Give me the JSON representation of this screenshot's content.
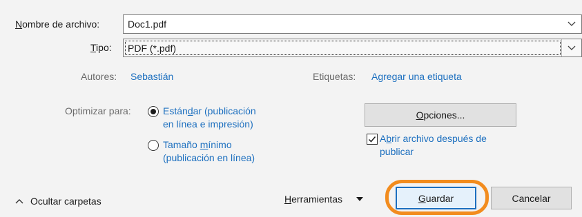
{
  "filename": {
    "label_prefix": "",
    "label_mnemonic": "N",
    "label_rest": "ombre de archivo:",
    "value": "Doc1.pdf"
  },
  "filetype": {
    "label_mnemonic": "T",
    "label_rest": "ipo:",
    "value": "PDF (*.pdf)"
  },
  "authors": {
    "label": "Autores:",
    "value": "Sebastián"
  },
  "tags": {
    "label": "Etiquetas:",
    "value": "Agregar una etiqueta"
  },
  "optimize": {
    "label": "Optimizar para:",
    "standard": {
      "line1_pre": "Están",
      "line1_mnemonic": "d",
      "line1_post": "ar (publicación",
      "line2": "en línea e impresión)",
      "selected": true
    },
    "minimum": {
      "line1_pre": "Tamaño ",
      "line1_mnemonic": "m",
      "line1_post": "ínimo",
      "line2": "(publicación en línea)",
      "selected": false
    }
  },
  "options_button": {
    "mnemonic": "O",
    "rest": "pciones..."
  },
  "open_after": {
    "line1_pre": "A",
    "line1_mnemonic": "b",
    "line1_post": "rir archivo después de",
    "line2": "publicar",
    "checked": true
  },
  "hide_folders": {
    "label": "Ocultar carpetas"
  },
  "tools": {
    "mnemonic": "H",
    "rest": "erramientas"
  },
  "save_button": {
    "mnemonic": "G",
    "rest": "uardar"
  },
  "cancel_button": {
    "label": "Cancelar"
  },
  "highlight_color": "#f28c1e"
}
